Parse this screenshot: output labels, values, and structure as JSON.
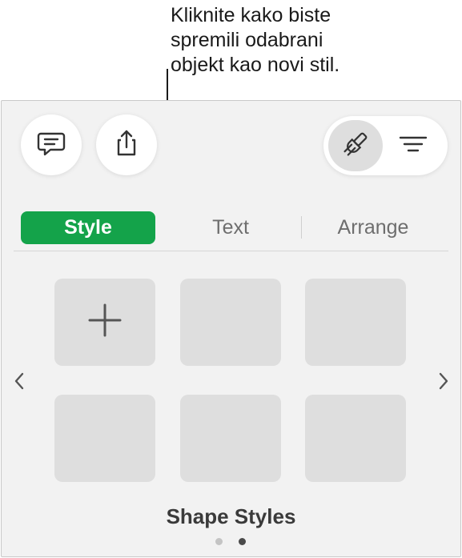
{
  "callout": {
    "text": "Kliknite kako biste\nspremili odabrani\nobjekt kao novi stil."
  },
  "toolbar": {
    "comment_icon": "comment-icon",
    "share_icon": "share-icon",
    "format_icon": "paintbrush-icon",
    "organize_icon": "sort-lines-icon"
  },
  "tabs": [
    {
      "label": "Style",
      "active": true
    },
    {
      "label": "Text",
      "active": false
    },
    {
      "label": "Arrange",
      "active": false
    }
  ],
  "styles_grid": {
    "add_icon": "plus-icon",
    "tile_count": 6
  },
  "section": {
    "title": "Shape Styles"
  },
  "pagination": {
    "pages": 2,
    "current": 2
  },
  "colors": {
    "accent": "#14a34a",
    "tile": "#dedede",
    "panel": "#f2f2f2"
  }
}
